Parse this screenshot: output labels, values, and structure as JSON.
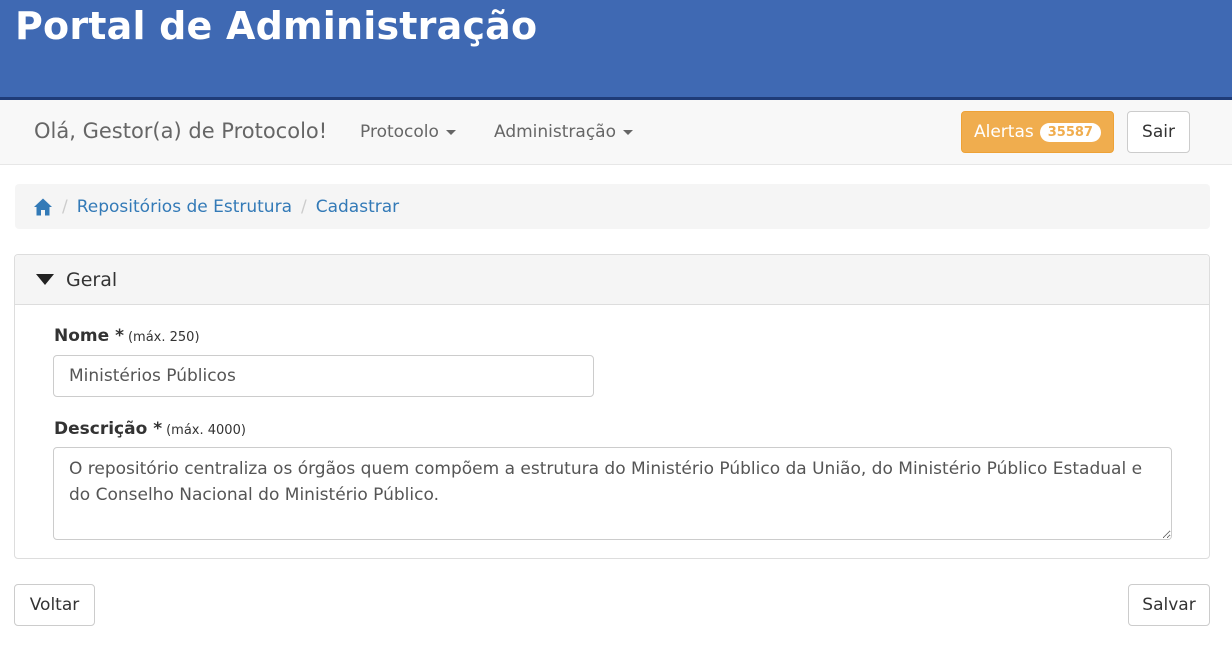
{
  "header": {
    "title": "Portal de Administração"
  },
  "navbar": {
    "greeting": "Olá, Gestor(a) de Protocolo!",
    "menus": [
      {
        "label": "Protocolo"
      },
      {
        "label": "Administração"
      }
    ],
    "alerts": {
      "label": "Alertas",
      "count": "35587",
      "color": "#f0ad4e"
    },
    "logout_label": "Sair"
  },
  "breadcrumb": {
    "home_icon": "home-icon",
    "items": [
      {
        "label": "Repositórios de Estrutura"
      },
      {
        "label": "Cadastrar"
      }
    ]
  },
  "panel": {
    "title": "Geral",
    "fields": {
      "nome": {
        "label": "Nome *",
        "hint": "(máx. 250)",
        "value": "Ministérios Públicos"
      },
      "descricao": {
        "label": "Descrição *",
        "hint": "(máx. 4000)",
        "value": "O repositório centraliza os órgãos quem compõem a estrutura do Ministério Público da União, do Ministério Público Estadual e do Conselho Nacional do Ministério Público."
      }
    }
  },
  "actions": {
    "back_label": "Voltar",
    "save_label": "Salvar"
  },
  "colors": {
    "header_bg": "#3f69b3",
    "link": "#337ab7"
  }
}
